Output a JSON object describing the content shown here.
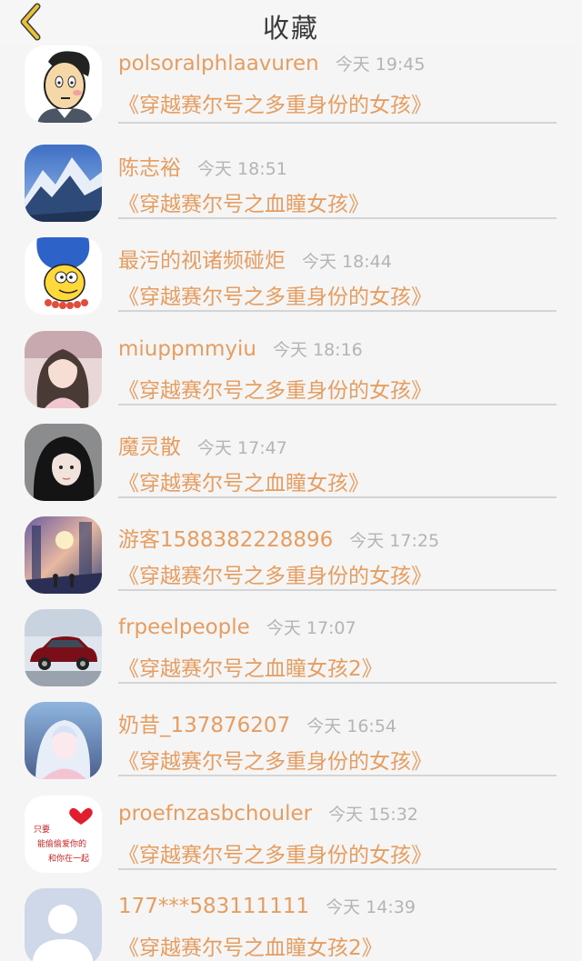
{
  "header": {
    "title": "收藏",
    "back_icon": "chevron-left-icon",
    "accent": "#e9c238"
  },
  "colors": {
    "name": "#e59d60",
    "time": "#b4b4b4",
    "divider": "#d4d4d4"
  },
  "items": [
    {
      "name": "polsoralphlaavuren",
      "time": "今天 19:45",
      "work": "《穿越赛尔号之多重身份的女孩》",
      "avatar": "cartoon-man-avatar"
    },
    {
      "name": "陈志裕",
      "time": "今天 18:51",
      "work": "《穿越赛尔号之血瞳女孩》",
      "avatar": "snowy-mountain-avatar"
    },
    {
      "name": "最污的视诸频碰炬",
      "time": "今天 18:44",
      "work": "《穿越赛尔号之多重身份的女孩》",
      "avatar": "marge-simpson-avatar"
    },
    {
      "name": "miuppmmyiu",
      "time": "今天 18:16",
      "work": "《穿越赛尔号之多重身份的女孩》",
      "avatar": "girl-photo-avatar"
    },
    {
      "name": "魔灵散",
      "time": "今天 17:47",
      "work": "《穿越赛尔号之血瞳女孩》",
      "avatar": "dark-hair-girl-avatar"
    },
    {
      "name": "游客1588382228896",
      "time": "今天 17:25",
      "work": "《穿越赛尔号之多重身份的女孩》",
      "avatar": "anime-scene-avatar"
    },
    {
      "name": "frpeelpeople",
      "time": "今天 17:07",
      "work": "《穿越赛尔号之血瞳女孩2》",
      "avatar": "red-car-avatar"
    },
    {
      "name": "奶昔_137876207",
      "time": "今天 16:54",
      "work": "《穿越赛尔号之多重身份的女孩》",
      "avatar": "anime-girl-avatar"
    },
    {
      "name": "proefnzasbchouler",
      "time": "今天 15:32",
      "work": "《穿越赛尔号之多重身份的女孩》",
      "avatar": "heart-text-avatar",
      "avatar_text": [
        "只要",
        "能偷偷爱你的",
        "和你在一起"
      ]
    },
    {
      "name": "177***583111111",
      "time": "今天 14:39",
      "work": "《穿越赛尔号之血瞳女孩2》",
      "avatar": "default-person-avatar"
    }
  ]
}
